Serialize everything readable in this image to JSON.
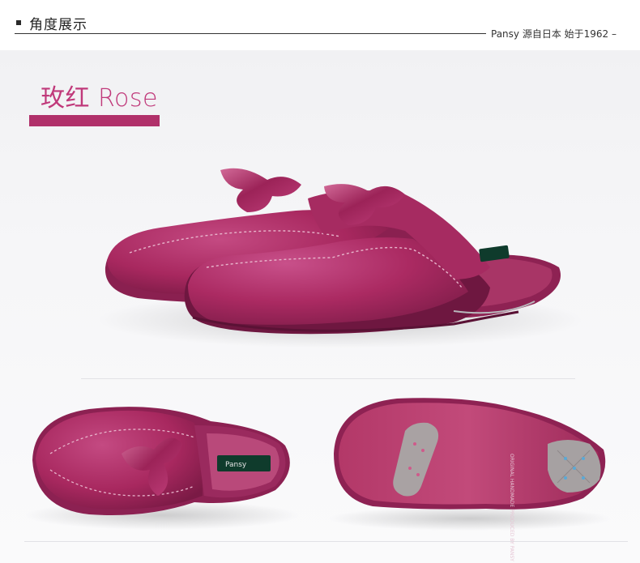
{
  "header": {
    "title": "角度展示",
    "tagline": "Pansy 源自日本  始于1962  –"
  },
  "product": {
    "color_label": "玫红 Rose",
    "colors": {
      "velvet": "#a8285f",
      "velvet_dark": "#7e1c47",
      "sole": "#b63a6c",
      "accent_bar": "#b0306a",
      "label_text": "#c0397a"
    }
  },
  "images": [
    {
      "name": "pair-angle-view"
    },
    {
      "name": "top-view"
    },
    {
      "name": "sole-view"
    }
  ],
  "insole_brand": "Pansy",
  "sole_text": "ORIGINAL HANDMADE PRODUCED BY PANSY"
}
